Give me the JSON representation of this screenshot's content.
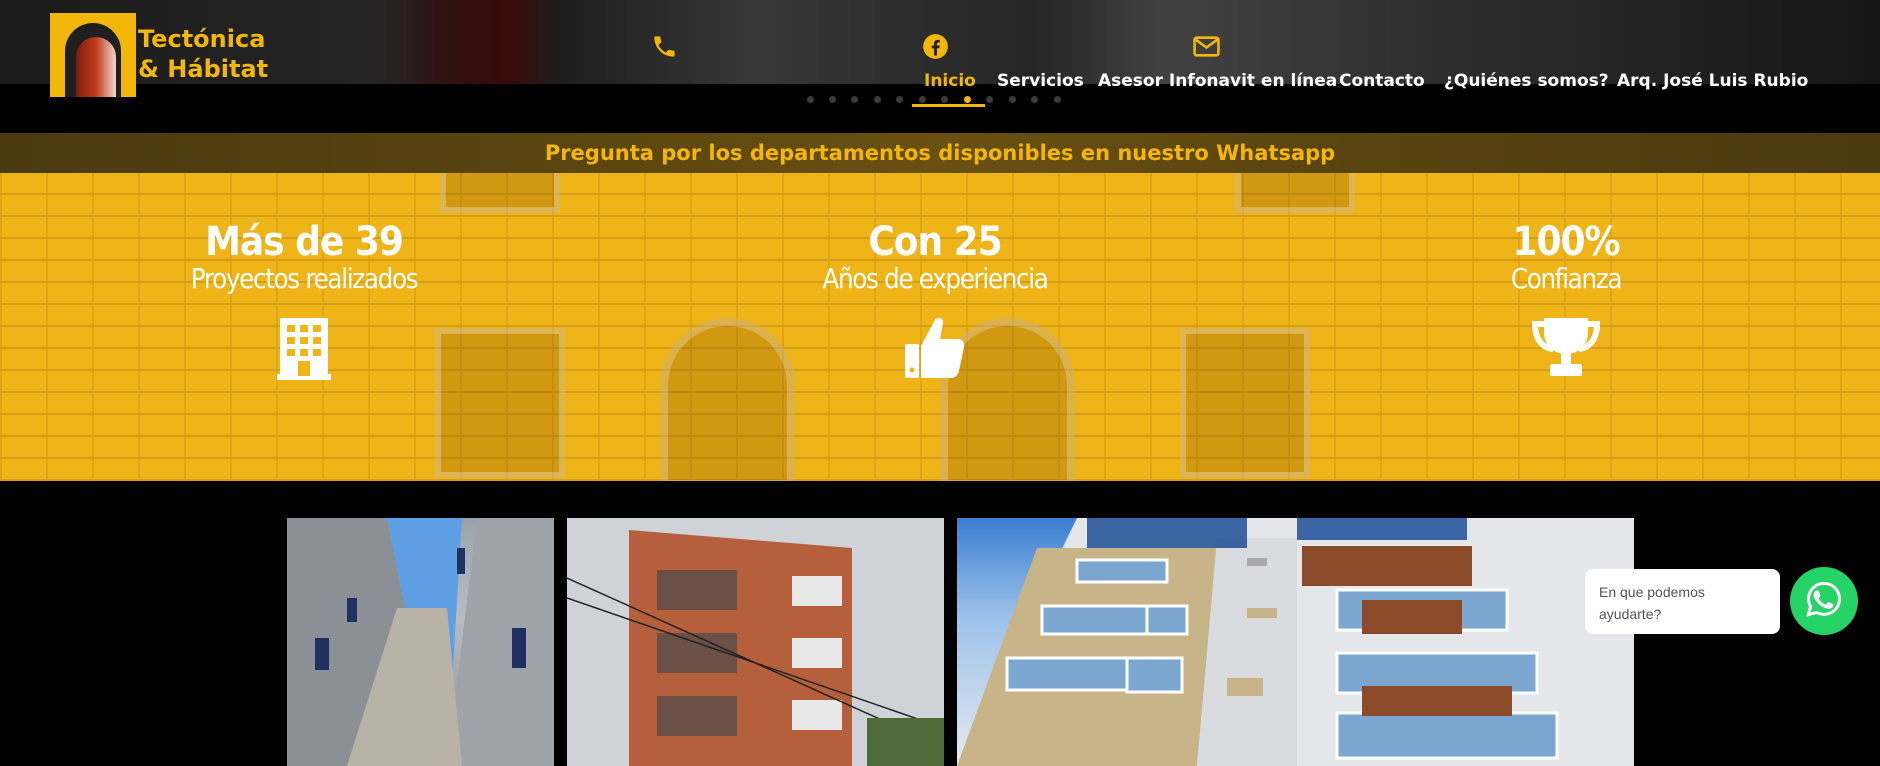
{
  "brand": {
    "line1": "Tectónica",
    "line2": "& Hábitat",
    "color": "#f3b60a"
  },
  "header_icons": [
    "phone-icon",
    "facebook-icon",
    "envelope-icon"
  ],
  "nav": {
    "items": [
      {
        "label": "Inicio",
        "active": true
      },
      {
        "label": "Servicios",
        "active": false
      },
      {
        "label": "Asesor Infonavit en línea",
        "active": false
      },
      {
        "label": "Contacto",
        "active": false
      },
      {
        "label": "¿Quiénes somos?",
        "active": false
      },
      {
        "label": "Arq. José Luis Rubio",
        "active": false
      }
    ]
  },
  "slider": {
    "total_dots": 12,
    "active_dot": 7
  },
  "whatsapp_banner": "Pregunta por los departamentos disponibles en nuestro Whatsapp",
  "stats": [
    {
      "number": "Más de 39",
      "label": "Proyectos realizados",
      "icon": "building-icon"
    },
    {
      "number": "Con 25",
      "label": "Años de experiencia",
      "icon": "thumbs-up-icon"
    },
    {
      "number": "100%",
      "label": "Confianza",
      "icon": "trophy-icon"
    }
  ],
  "gallery": [
    "photo-corridor",
    "photo-brick-building",
    "photo-white-building"
  ],
  "chat": {
    "bubble_text": "En que podemos ayudarte?",
    "button_icon": "whatsapp-icon"
  },
  "colors": {
    "accent": "#f3b60a",
    "whatsapp": "#25d366"
  }
}
